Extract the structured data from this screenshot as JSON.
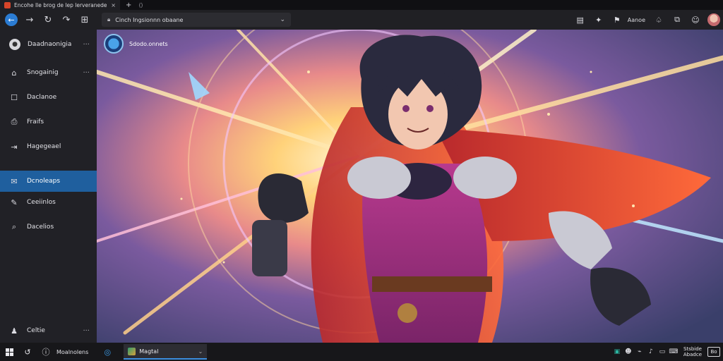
{
  "tab": {
    "title": "Encohe Ile brog de lep lerveranedes",
    "close_glyph": "×",
    "new_tab_glyph": "+",
    "extra_glyph": "⟨⟩"
  },
  "toolbar": {
    "address_text": "Cinch Ingsionnn obaane",
    "right_label": "Aanoe"
  },
  "sidebar": {
    "profile_label": "Daadnaonigia",
    "items": [
      {
        "label": "Snogainig",
        "icon": "home-icon",
        "glyph": "⌂",
        "more": "···"
      },
      {
        "label": "Daclanoe",
        "icon": "square-icon",
        "glyph": "☐",
        "more": ""
      },
      {
        "label": "Fraifs",
        "icon": "document-icon",
        "glyph": "⎙",
        "more": ""
      },
      {
        "label": "Hagegeael",
        "icon": "export-icon",
        "glyph": "⇥",
        "more": ""
      },
      {
        "label": "Dcnoleaps",
        "icon": "inbox-icon",
        "glyph": "✉",
        "more": ""
      },
      {
        "label": "Ceeiinlos",
        "icon": "edit-icon",
        "glyph": "✎",
        "more": ""
      },
      {
        "label": "Dacelios",
        "icon": "search-icon",
        "glyph": "⌕",
        "more": ""
      }
    ],
    "bottom_label": "Celtie",
    "more_glyph": "···"
  },
  "content": {
    "chip_label": "Sdodo.onnets"
  },
  "taskbar": {
    "search_label": "Moalnolens",
    "app_label": "Magtal",
    "clock_top": "Stsbide",
    "clock_bottom": "Abadce",
    "notif_label": "Bo"
  },
  "colors": {
    "accent": "#1f5f9e",
    "sidebar_bg": "#212126",
    "toolbar_bg": "#202024",
    "taskbar_bg": "#17171a"
  }
}
